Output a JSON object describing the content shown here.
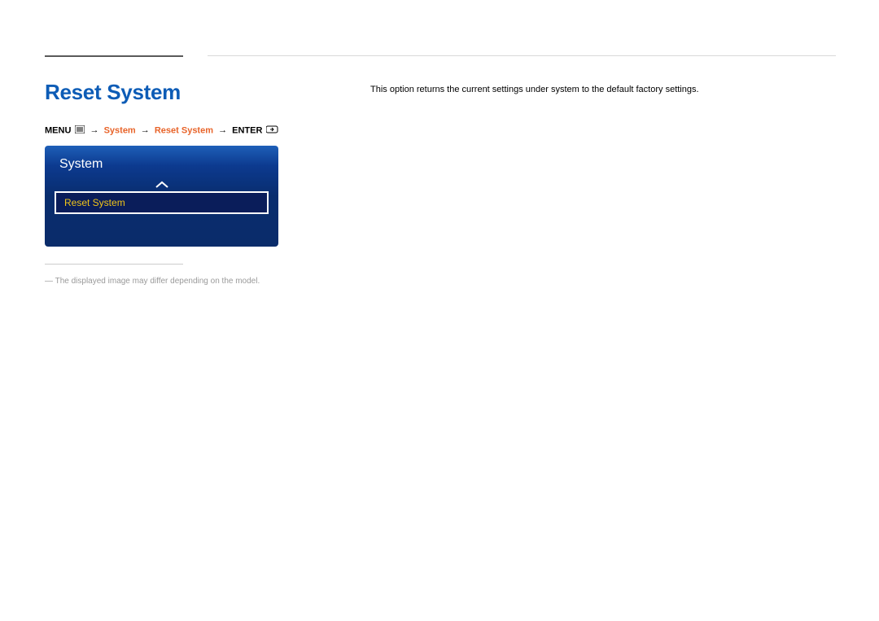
{
  "heading": "Reset System",
  "breadcrumb": {
    "menu": "MENU",
    "system": "System",
    "reset_system": "Reset System",
    "enter": "ENTER"
  },
  "menu_panel": {
    "title": "System",
    "item": "Reset System"
  },
  "footnote": "―  The displayed image may differ depending on the model.",
  "description": "This option returns the current settings under system to the default factory settings."
}
